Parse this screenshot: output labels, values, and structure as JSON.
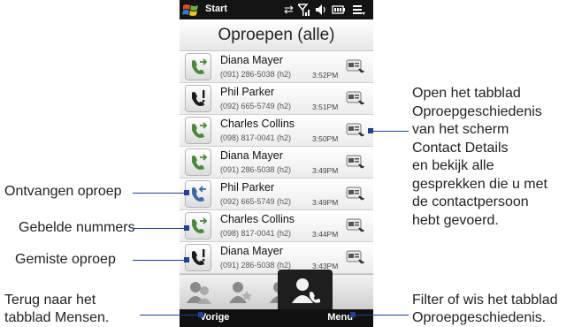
{
  "status": {
    "start_label": "Start"
  },
  "title": "Oproepen (alle)",
  "calls": [
    {
      "name": "Diana Mayer",
      "number": "(091) 286-5038 (h2)",
      "time": "3:52PM",
      "type": "outgoing"
    },
    {
      "name": "Phil Parker",
      "number": "(092) 665-5749 (h2)",
      "time": "3:51PM",
      "type": "missed"
    },
    {
      "name": "Charles Collins",
      "number": "(098) 817-0041 (h2)",
      "time": "3:50PM",
      "type": "outgoing"
    },
    {
      "name": "Diana Mayer",
      "number": "(091) 286-5038 (h2)",
      "time": "3:49PM",
      "type": "outgoing"
    },
    {
      "name": "Phil Parker",
      "number": "(092) 665-5749 (h2)",
      "time": "3:49PM",
      "type": "received"
    },
    {
      "name": "Charles Collins",
      "number": "(098) 817-0041 (h2)",
      "time": "3:44PM",
      "type": "outgoing"
    },
    {
      "name": "Diana Mayer",
      "number": "(091) 286-5038 (h2)",
      "time": "3:43PM",
      "type": "missed"
    }
  ],
  "tabs": [
    {
      "name": "people-tab-icon"
    },
    {
      "name": "favorites-tab-icon"
    },
    {
      "name": "recent-tab-icon"
    },
    {
      "name": "call-history-tab-icon"
    }
  ],
  "softkeys": {
    "left": "Vorige",
    "right": "Menu"
  },
  "annotations": {
    "received": "Ontvangen oproep",
    "dialed": "Gebelde nummers",
    "missed": "Gemiste oproep",
    "back_line1": "Terug naar het",
    "back_line2": "tabblad Mensen.",
    "history_lines": [
      "Open het tabblad",
      "Oproepgeschiedenis",
      "van het scherm",
      "Contact Details",
      "en bekijk alle",
      "gesprekken die u met",
      "de contactpersoon",
      "hebt gevoerd."
    ],
    "filter_line1": "Filter of wis het tabblad",
    "filter_line2": "Oproepgeschiedenis."
  },
  "colors": {
    "annotation_line": "#1f3f9a",
    "missed_icon": "#1c1c1c",
    "bar": "#141414"
  }
}
